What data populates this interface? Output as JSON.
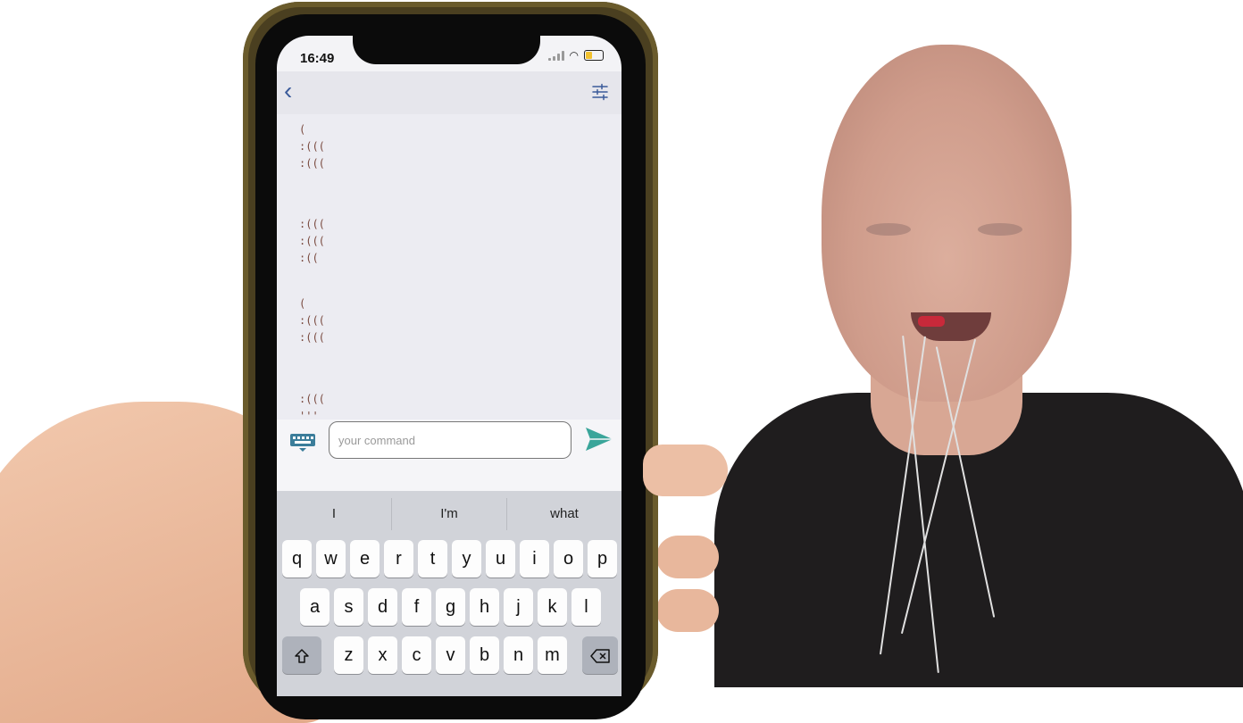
{
  "status_bar": {
    "time": "16:49"
  },
  "chat": {
    "messages": [
      {
        "text": "(\n:(((\n:((("
      },
      {
        "text": ":(((\n:(((\n:(("
      },
      {
        "text": "(\n:(((\n:((("
      },
      {
        "text": ":(((\n'''"
      }
    ]
  },
  "composer": {
    "placeholder": "your command"
  },
  "keyboard": {
    "suggestions": [
      "I",
      "I'm",
      "what"
    ],
    "rows": [
      [
        "q",
        "w",
        "e",
        "r",
        "t",
        "y",
        "u",
        "i",
        "o",
        "p"
      ],
      [
        "a",
        "s",
        "d",
        "f",
        "g",
        "h",
        "j",
        "k",
        "l"
      ],
      [
        "z",
        "x",
        "c",
        "v",
        "b",
        "n",
        "m"
      ]
    ]
  },
  "colors": {
    "accent": "#3aa59a",
    "nav_icon": "#3a5a9a",
    "message_text": "#7a4b40"
  }
}
